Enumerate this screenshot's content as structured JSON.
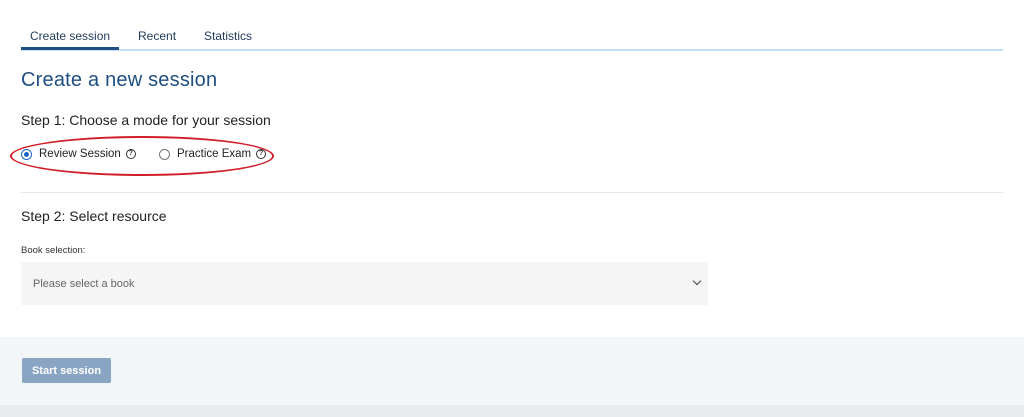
{
  "tabs": [
    {
      "label": "Create session",
      "active": true
    },
    {
      "label": "Recent",
      "active": false
    },
    {
      "label": "Statistics",
      "active": false
    }
  ],
  "page_title": "Create a new session",
  "step1": {
    "heading": "Step 1: Choose a mode for your session",
    "options": [
      {
        "label": "Review Session",
        "selected": true,
        "help_icon": "question-circle-icon"
      },
      {
        "label": "Practice Exam",
        "selected": false,
        "help_icon": "question-circle-icon"
      }
    ]
  },
  "step2": {
    "heading": "Step 2: Select resource",
    "book_label": "Book selection:",
    "book_placeholder": "Please select a book"
  },
  "start_button": "Start session",
  "colors": {
    "accent": "#1f4e82",
    "highlight": "#d11f2a",
    "button_disabled": "#8aa4c4"
  }
}
